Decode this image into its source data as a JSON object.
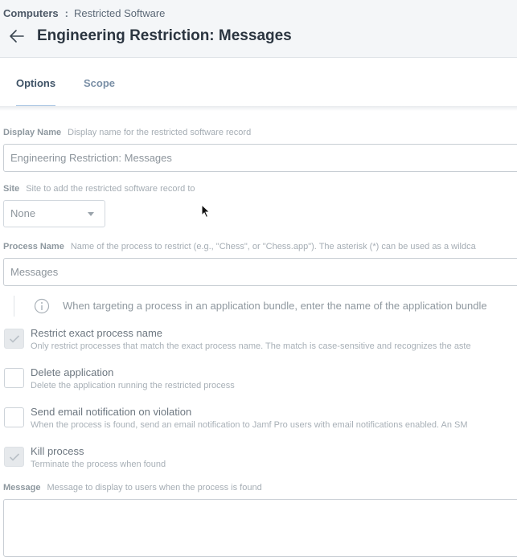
{
  "breadcrumb": {
    "root": "Computers",
    "separator": ":",
    "current": "Restricted Software"
  },
  "page_title": "Engineering Restriction: Messages",
  "tabs": [
    {
      "label": "Options",
      "active": true
    },
    {
      "label": "Scope",
      "active": false
    }
  ],
  "form": {
    "display_name": {
      "label": "Display Name",
      "hint": "Display name for the restricted software record",
      "value": "Engineering Restriction: Messages"
    },
    "site": {
      "label": "Site",
      "hint": "Site to add the restricted software record to",
      "value": "None"
    },
    "process_name": {
      "label": "Process Name",
      "hint": "Name of the process to restrict (e.g., \"Chess\", or \"Chess.app\"). The asterisk (*) can be used as a wildca",
      "value": "Messages"
    },
    "info_note": "When targeting a process in an application bundle, enter the name of the application bundle",
    "options": [
      {
        "title": "Restrict exact process name",
        "desc": "Only restrict processes that match the exact process name. The match is case-sensitive and recognizes the aste",
        "checked": true
      },
      {
        "title": "Delete application",
        "desc": "Delete the application running the restricted process",
        "checked": false
      },
      {
        "title": "Send email notification on violation",
        "desc": "When the process is found, send an email notification to Jamf Pro users with email notifications enabled. An SM",
        "checked": false
      },
      {
        "title": "Kill process",
        "desc": "Terminate the process when found",
        "checked": true
      }
    ],
    "message": {
      "label": "Message",
      "hint": "Message to display to users when the process is found",
      "value": ""
    }
  },
  "icons": {
    "back": "arrow-left-icon",
    "info": "info-circle-icon",
    "check": "checkmark-icon",
    "caret": "chevron-down-icon"
  },
  "colors": {
    "header_bg": "#f4f6f8",
    "active_tab": "#3e5266",
    "tab_underline": "#a8c4e2",
    "title": "#2b3540"
  }
}
